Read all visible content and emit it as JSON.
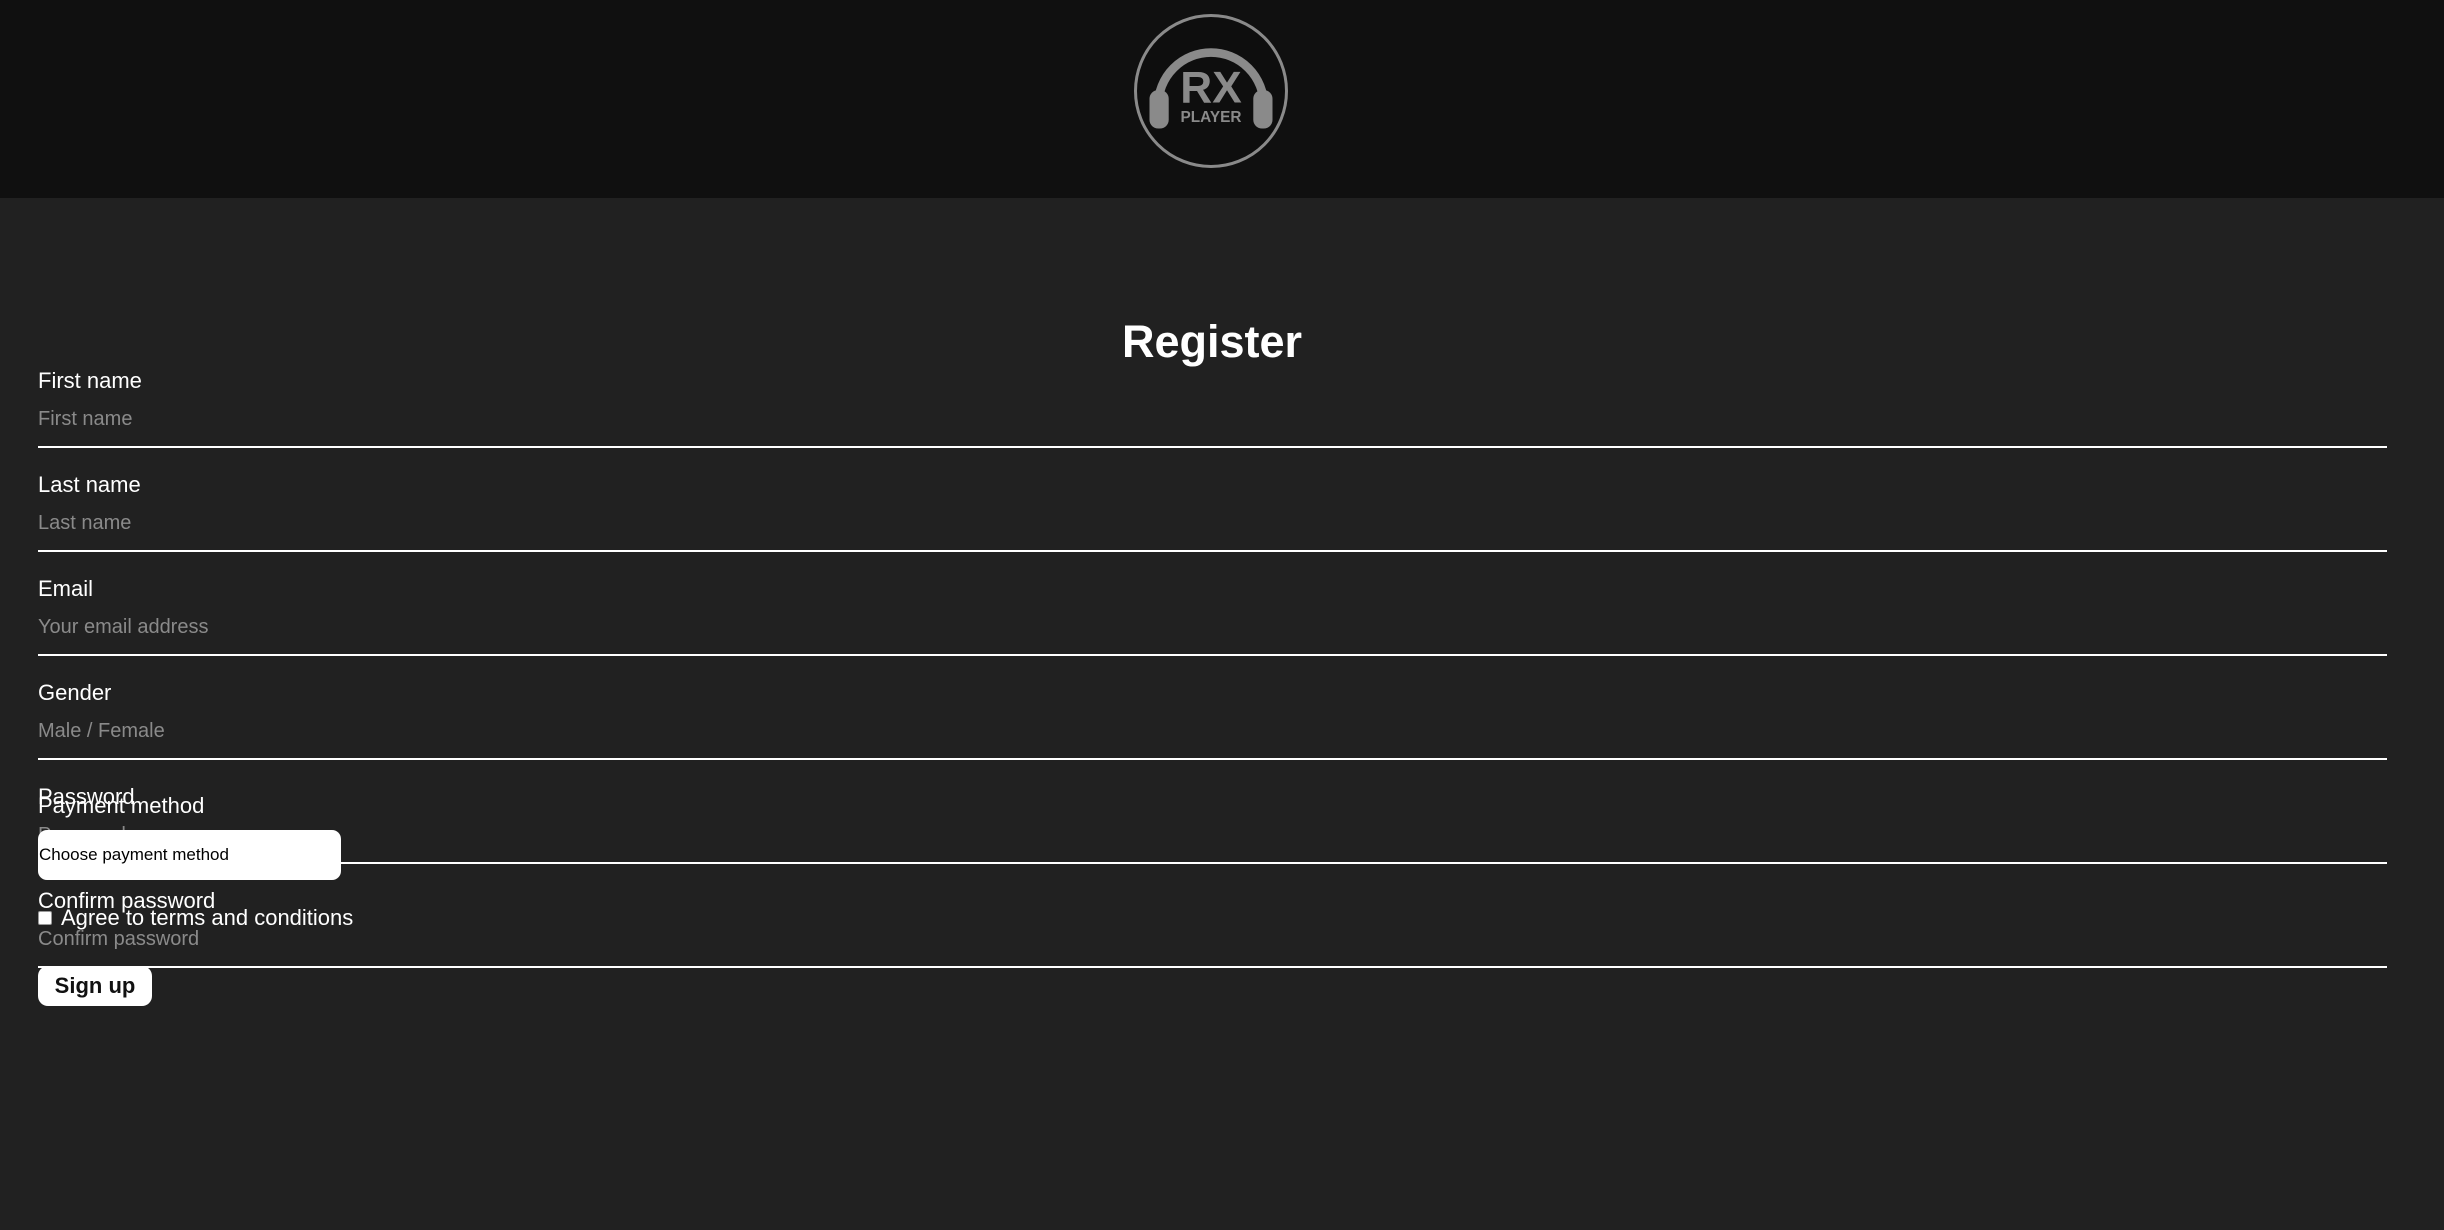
{
  "header": {
    "logo": {
      "icon": "headphones-logo-icon",
      "title_text": "RX",
      "subtitle_text": "PLAYER",
      "color": "#8a8a8a"
    }
  },
  "form": {
    "title": "Register",
    "fields": [
      {
        "label": "First name",
        "placeholder": "First name",
        "value": ""
      },
      {
        "label": "Last name",
        "placeholder": "Last name",
        "value": ""
      },
      {
        "label": "Email",
        "placeholder": "Your email address",
        "value": ""
      },
      {
        "label": "Gender",
        "placeholder": "Male / Female",
        "value": ""
      },
      {
        "label": "Password",
        "placeholder": "Password",
        "value": ""
      },
      {
        "label": "Confirm password",
        "placeholder": "Confirm password",
        "value": ""
      }
    ],
    "payment": {
      "label": "Payment method",
      "selected": "Choose payment method"
    },
    "terms": {
      "label": "Agree to terms and conditions",
      "checked": false
    },
    "submit_label": "Sign up"
  },
  "colors": {
    "header_bg": "#101010",
    "page_bg": "#212121",
    "text": "#ffffff",
    "placeholder": "#8a8a8a"
  }
}
